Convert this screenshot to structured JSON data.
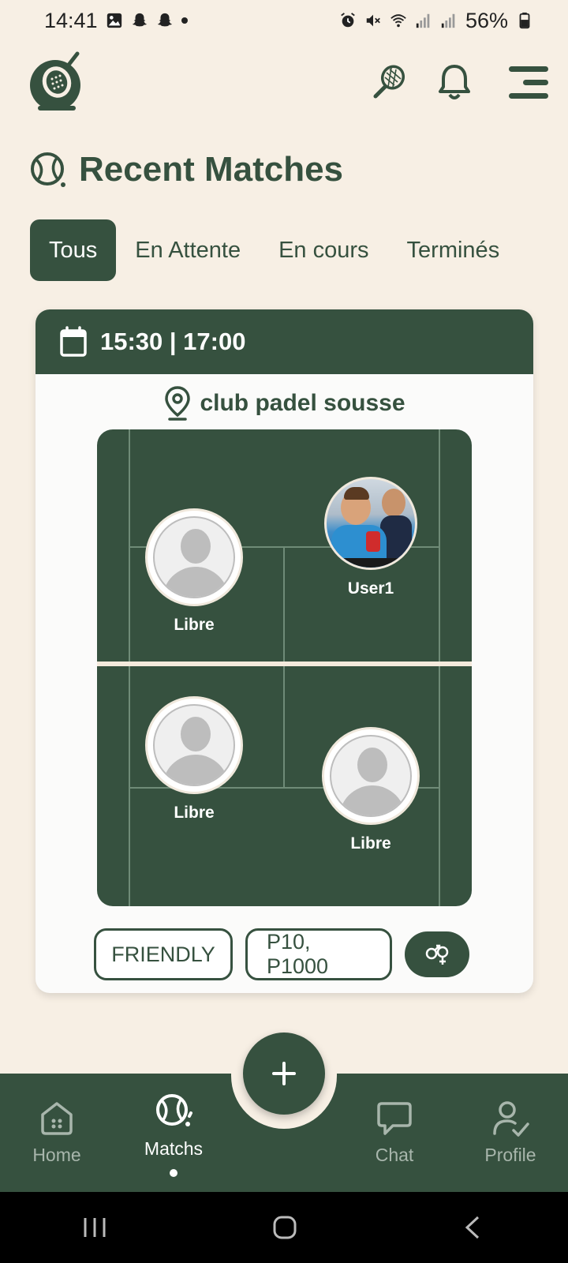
{
  "status_bar": {
    "time": "14:41",
    "battery": "56%"
  },
  "header": {
    "title": "Recent Matches"
  },
  "tabs": [
    {
      "label": "Tous",
      "active": true
    },
    {
      "label": "En Attente",
      "active": false
    },
    {
      "label": "En cours",
      "active": false
    },
    {
      "label": "Terminés",
      "active": false
    }
  ],
  "match": {
    "time": "15:30 | 17:00",
    "location": "club padel sousse",
    "players": [
      {
        "label": "Libre",
        "has_photo": false
      },
      {
        "label": "User1",
        "has_photo": true
      },
      {
        "label": "Libre",
        "has_photo": false
      },
      {
        "label": "Libre",
        "has_photo": false
      }
    ],
    "type": "FRIENDLY",
    "levels": "P10, P1000",
    "gender_icon": "mixed-gender-icon"
  },
  "nav": {
    "items": [
      {
        "label": "Home",
        "icon": "home-icon",
        "active": false
      },
      {
        "label": "Matchs",
        "icon": "ball-icon",
        "active": true
      },
      {
        "label": "Chat",
        "icon": "chat-icon",
        "active": false
      },
      {
        "label": "Profile",
        "icon": "profile-check-icon",
        "active": false
      }
    ],
    "fab_icon": "plus-icon"
  },
  "colors": {
    "primary": "#36513f",
    "background": "#f7efe4",
    "card": "#fbfbfa"
  }
}
